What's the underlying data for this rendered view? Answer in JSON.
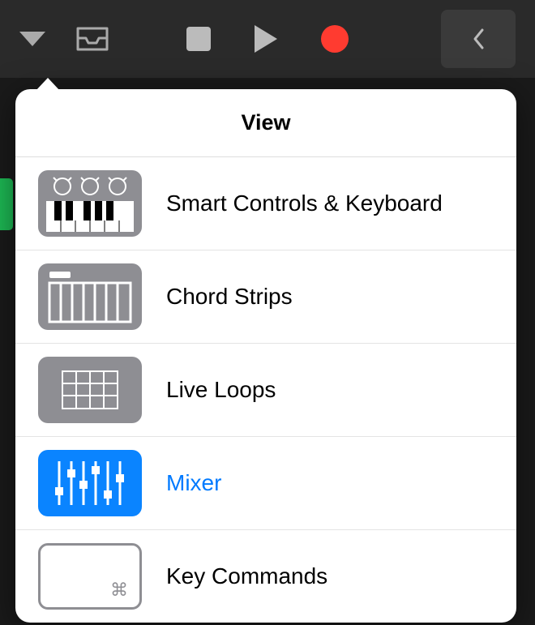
{
  "popover": {
    "title": "View",
    "items": [
      {
        "label": "Smart Controls & Keyboard",
        "active": false
      },
      {
        "label": "Chord Strips",
        "active": false
      },
      {
        "label": "Live Loops",
        "active": false
      },
      {
        "label": "Mixer",
        "active": true
      },
      {
        "label": "Key Commands",
        "active": false
      }
    ]
  }
}
